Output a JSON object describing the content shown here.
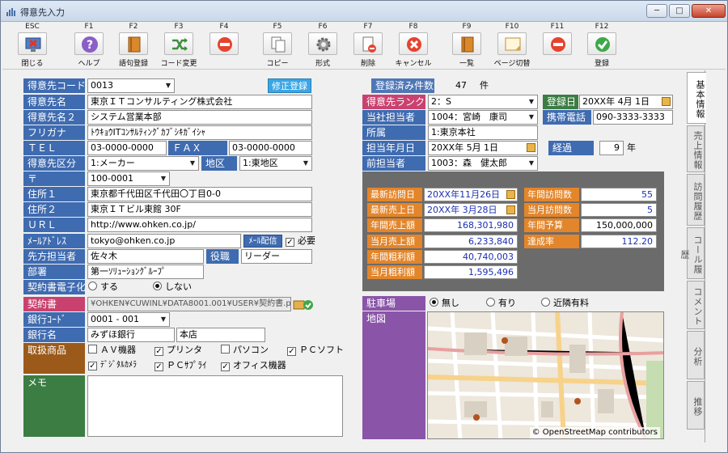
{
  "window": {
    "title": "得意先入力",
    "min": "─",
    "max": "□",
    "close": "✕"
  },
  "toolbar": [
    {
      "key": "ESC",
      "label": "閉じる"
    },
    {
      "key": "F1",
      "label": "ヘルプ"
    },
    {
      "key": "F2",
      "label": "語句登録"
    },
    {
      "key": "F3",
      "label": "コード変更"
    },
    {
      "key": "F4",
      "label": ""
    },
    {
      "key": "F5",
      "label": "コピー"
    },
    {
      "key": "F6",
      "label": "形式"
    },
    {
      "key": "F7",
      "label": "削除"
    },
    {
      "key": "F8",
      "label": "キャンセル"
    },
    {
      "key": "F9",
      "label": "一覧"
    },
    {
      "key": "F10",
      "label": "ページ切替"
    },
    {
      "key": "F11",
      "label": ""
    },
    {
      "key": "F12",
      "label": "登録"
    }
  ],
  "left": {
    "code_label": "得意先コード",
    "code_value": "0013",
    "modify_btn": "修正登録",
    "name_label": "得意先名",
    "name_value": "東京ＩＴコンサルティング株式会社",
    "name2_label": "得意先名２",
    "name2_value": "システム営業本部",
    "kana_label": "フリガナ",
    "kana_value": "ﾄｳｷｮｳITｺﾝｻﾙﾃｨﾝｸﾞｶﾌﾞｼｷｶﾞｲｼｬ",
    "tel_label": "ＴＥＬ",
    "tel_value": "03-0000-0000",
    "fax_label": "ＦＡＸ",
    "fax_value": "03-0000-0000",
    "kubun_label": "得意先区分",
    "kubun_value": "1:メーカー",
    "area_label": "地区",
    "area_value": "1:東地区",
    "zip_label": "〒",
    "zip_value": "100-0001",
    "addr1_label": "住所１",
    "addr1_value": "東京都千代田区千代田〇丁目0-0",
    "addr2_label": "住所２",
    "addr2_value": "東京ＩＴビル東館 30F",
    "url_label": "ＵＲＬ",
    "url_value": "http://www.ohken.co.jp/",
    "mail_label": "ﾒｰﾙｱﾄﾞﾚｽ",
    "mail_value": "tokyo@ohken.co.jp",
    "mail_btn": "ﾒｰﾙ配信",
    "mail_check": "必要",
    "tanto_label": "先方担当者",
    "tanto_value": "佐々木",
    "yaku_label": "役職",
    "yaku_value": "リーダー",
    "busho_label": "部署",
    "busho_value": "第一ｿﾘｭｰｼｮﾝｸﾞﾙｰﾌﾟ",
    "keiyaku_denshi_label": "契約書電子化",
    "opt_yes": "する",
    "opt_no": "しない",
    "keiyaku_label": "契約書",
    "keiyaku_value": "¥OHKEN¥CUWINL¥DATA8001.001¥USER¥契約書.pdf",
    "bank_code_label": "銀行ｺｰﾄﾞ",
    "bank_code_value": "0001 - 001",
    "bank_label": "銀行名",
    "bank_value": "みずほ銀行",
    "branch_value": "本店",
    "goods_label": "取扱商品",
    "goods": [
      {
        "label": "ＡＶ機器",
        "checked": false
      },
      {
        "label": "プリンタ",
        "checked": true
      },
      {
        "label": "パソコン",
        "checked": false
      },
      {
        "label": "ＰＣソフト",
        "checked": true
      },
      {
        "label": "ﾃﾞｼﾞﾀﾙｶﾒﾗ",
        "checked": true
      },
      {
        "label": "ＰＣｻﾌﾟﾗｲ",
        "checked": true
      },
      {
        "label": "オフィス機器",
        "checked": true
      }
    ],
    "memo_label": "メモ"
  },
  "right": {
    "count_label": "登録済み件数",
    "count_value": "47",
    "count_unit": "件",
    "rank_label": "得意先ランク",
    "rank_value": "2：S",
    "reg_label": "登録日",
    "reg_value": "20XX年 4月 1日",
    "our_tanto_label": "当社担当者",
    "our_tanto_value": "1004：宮崎　康司",
    "mobile_label": "携帯電話",
    "mobile_value": "090-3333-3333",
    "office_label": "所属",
    "office_value": "1:東京本社",
    "ym_label": "担当年月日",
    "ym_value": "20XX年 5月 1日",
    "elapsed_label": "経過",
    "elapsed_value": "9",
    "elapsed_unit": "年",
    "prev_label": "前担当者",
    "prev_value": "1003：森　健太郎",
    "stats": {
      "last_visit_label": "最新訪問日",
      "last_visit_value": "20XX年11月26日",
      "last_sale_label": "最新売上日",
      "last_sale_value": "20XX年 3月28日",
      "year_sales_label": "年間売上額",
      "year_sales_value": "168,301,980",
      "month_sales_label": "当月売上額",
      "month_sales_value": "6,233,840",
      "year_gp_label": "年間粗利額",
      "year_gp_value": "40,740,003",
      "month_gp_label": "当月粗利額",
      "month_gp_value": "1,595,496",
      "year_visits_label": "年間訪問数",
      "year_visits_value": "55",
      "month_visits_label": "当月訪問数",
      "month_visits_value": "5",
      "budget_label": "年間予算",
      "budget_value": "150,000,000",
      "achieve_label": "達成率",
      "achieve_value": "112.20"
    },
    "parking_label": "駐車場",
    "park_none": "無し",
    "park_yes": "有り",
    "park_near": "近隣有料",
    "map_label": "地図",
    "map_credit": "© OpenStreetMap contributors"
  },
  "tabs": [
    "基本情報",
    "売上情報",
    "訪問履歴",
    "コール履歴",
    "コメント",
    "分析",
    "推移"
  ]
}
